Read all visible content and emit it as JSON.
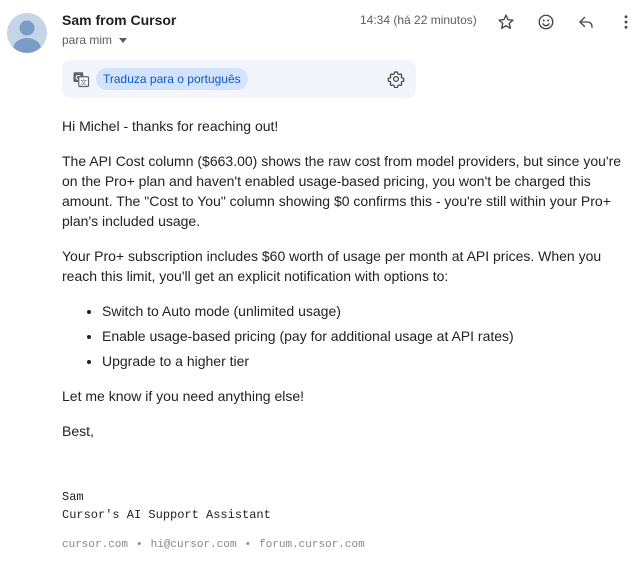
{
  "sender": {
    "name": "Sam from Cursor",
    "recipients_label": "para mim",
    "timestamp": "14:34 (há 22 minutos)"
  },
  "toolbar": {
    "icons": [
      "star-icon",
      "emoji-icon",
      "reply-icon",
      "more-vert-icon"
    ]
  },
  "translate": {
    "link_label": "Traduza para o português",
    "icons": [
      "translate-icon",
      "settings-gear-icon"
    ]
  },
  "email": {
    "greeting": "Hi Michel - thanks for reaching out!",
    "paragraph1": "The API Cost column ($663.00) shows the raw cost from model providers, but since you're on the Pro+ plan and haven't enabled usage-based pricing, you won't be charged this amount. The \"Cost to You\" column showing $0 confirms this - you're still within your Pro+ plan's included usage.",
    "paragraph2": "Your Pro+ subscription includes $60 worth of usage per month at API prices. When you reach this limit, you'll get an explicit notification with options to:",
    "options": [
      "Switch to Auto mode (unlimited usage)",
      "Enable usage-based pricing (pay for additional usage at API rates)",
      "Upgrade to a higher tier"
    ],
    "closing": "Let me know if you need anything else!",
    "signoff": "Best,"
  },
  "signature": {
    "name": "Sam",
    "title": "Cursor's AI Support Assistant"
  },
  "footer": {
    "links": [
      "cursor.com",
      "hi@cursor.com",
      "forum.cursor.com"
    ],
    "separator": "•"
  },
  "colors": {
    "link_blue": "#0b57d0",
    "translate_bg": "#f2f6fc",
    "chip_bg": "#d3e3fd",
    "avatar_bg": "#c5d5e8"
  }
}
